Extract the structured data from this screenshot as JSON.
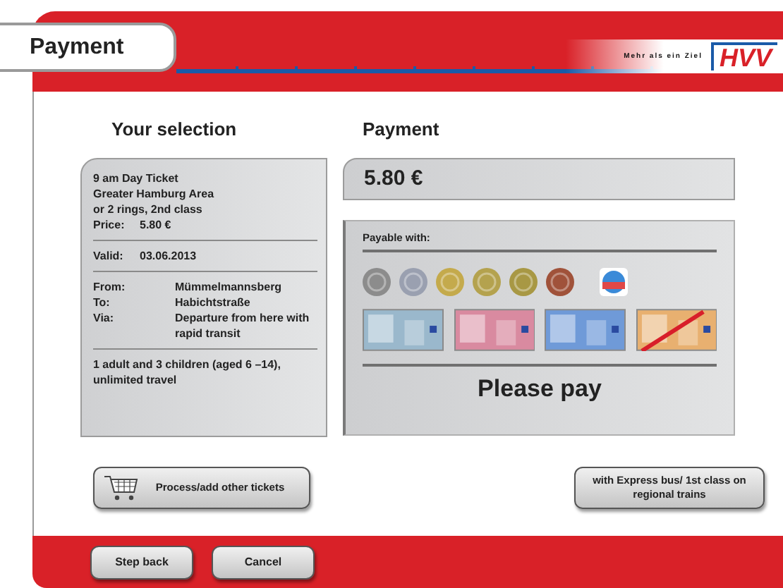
{
  "title": "Payment",
  "brand": {
    "slogan": "Mehr als ein Ziel",
    "logo": "HVV"
  },
  "selection": {
    "heading": "Your selection",
    "ticket_lines": [
      "9 am Day Ticket",
      "Greater Hamburg Area",
      "or 2 rings, 2nd class"
    ],
    "price": {
      "label": "Price:",
      "value": "5.80 €"
    },
    "valid": {
      "label": "Valid:",
      "value": "03.06.2013"
    },
    "route": [
      {
        "label": "From:",
        "value": "Mümmelmannsberg"
      },
      {
        "label": "To:",
        "value": "Habichtstraße"
      },
      {
        "label": "Via:",
        "value": "Departure from here with rapid transit"
      }
    ],
    "travellers": "1 adult and 3 children (aged 6 –14), unlimited travel"
  },
  "payment": {
    "heading": "Payment",
    "amount": "5.80 €",
    "payable_heading": "Payable with:",
    "methods": [
      {
        "kind": "coin",
        "color": "#8c8c8c",
        "accepted": true
      },
      {
        "kind": "coin",
        "color": "#9aa0b0",
        "accepted": true
      },
      {
        "kind": "coin",
        "color": "#c4aa4c",
        "accepted": true
      },
      {
        "kind": "coin",
        "color": "#b4a24e",
        "accepted": true
      },
      {
        "kind": "coin",
        "color": "#a89844",
        "accepted": true
      },
      {
        "kind": "coin",
        "color": "#a0523a",
        "accepted": true
      },
      {
        "kind": "card",
        "color": "#3a8ad8",
        "accepted": true
      },
      {
        "kind": "note",
        "color": "#9ab8cc",
        "accepted": true
      },
      {
        "kind": "note",
        "color": "#d98aa0",
        "accepted": true
      },
      {
        "kind": "note",
        "color": "#6f9ad8",
        "accepted": true
      },
      {
        "kind": "note",
        "color": "#e8b070",
        "accepted": false
      }
    ],
    "prompt": "Please pay"
  },
  "actions": [
    {
      "label": "Process/add other tickets",
      "kind": "cart"
    },
    {
      "label": "with Express bus/ 1st class on regional trains",
      "kind": "plain"
    }
  ],
  "footer_buttons": [
    "Step back",
    "Cancel"
  ]
}
